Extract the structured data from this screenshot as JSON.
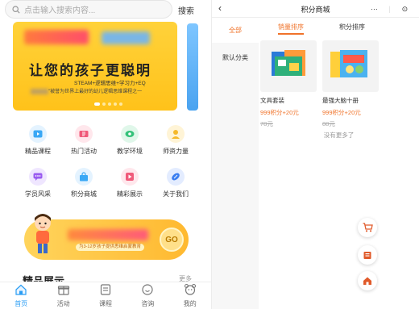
{
  "left": {
    "search": {
      "placeholder": "点击输入搜索内容...",
      "button_label": "搜索"
    },
    "banner": {
      "headline": "让您的孩子更聪明",
      "subline": "STEAM+逻辑思维+学习力+EQ",
      "caption": "被誉为世界上最好的幼儿逻辑思维课程之一"
    },
    "grid": [
      {
        "label": "精品课程",
        "icon": "video-icon",
        "color": "#3aa8f5"
      },
      {
        "label": "热门活动",
        "icon": "ticket-icon",
        "color": "#f05a7a"
      },
      {
        "label": "教学环境",
        "icon": "eye-icon",
        "color": "#34c27a"
      },
      {
        "label": "师资力量",
        "icon": "teacher-icon",
        "color": "#f5b92a"
      },
      {
        "label": "学员风采",
        "icon": "chat-icon",
        "color": "#9a5cf0"
      },
      {
        "label": "积分商城",
        "icon": "bag-icon",
        "color": "#3aa8f5"
      },
      {
        "label": "精彩展示",
        "icon": "play-icon",
        "color": "#f05a7a"
      },
      {
        "label": "关于我们",
        "icon": "rugby-icon",
        "color": "#3a7df0"
      }
    ],
    "promo": {
      "pill": "为3-12岁孩子提供思维启蒙教育",
      "go_label": "GO"
    },
    "section": {
      "title": "精品展示",
      "more": "更多"
    },
    "tabs": [
      {
        "label": "首页",
        "icon": "home-icon",
        "active": true
      },
      {
        "label": "活动",
        "icon": "gift-icon",
        "active": false
      },
      {
        "label": "课程",
        "icon": "book-icon",
        "active": false
      },
      {
        "label": "咨询",
        "icon": "message-icon",
        "active": false
      },
      {
        "label": "我的",
        "icon": "user-icon",
        "active": false
      }
    ]
  },
  "right": {
    "nav": {
      "back": "‹",
      "title": "积分商城",
      "capsule_menu": "···",
      "capsule_close": "⊙"
    },
    "sidebar": [
      {
        "label": "全部",
        "active": true
      },
      {
        "label": "默认分类",
        "active": false
      }
    ],
    "sort": [
      {
        "label": "销量排序",
        "active": true
      },
      {
        "label": "积分排序",
        "active": false
      }
    ],
    "products": [
      {
        "name": "文具套装",
        "points": "999积分",
        "plus": "+20元",
        "original": "78元"
      },
      {
        "name": "最强大脑十册",
        "points": "999积分",
        "plus": "+20元",
        "original": "88元"
      }
    ],
    "no_more": "没有更多了",
    "fabs": [
      "cart-icon",
      "shop-icon",
      "home-icon"
    ],
    "accent": "#f0732a"
  }
}
